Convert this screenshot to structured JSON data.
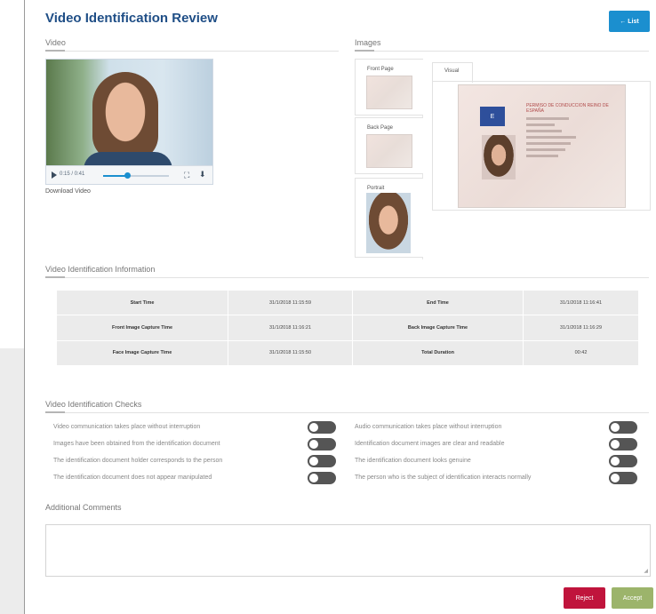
{
  "page": {
    "title": "Video Identification Review",
    "list_button": "List",
    "list_icon": "←"
  },
  "video_section": {
    "heading": "Video",
    "time": "0:15 / 0:41",
    "progress": 0.37,
    "download_link": "Download Video"
  },
  "images_section": {
    "heading": "Images",
    "thumbnails": [
      {
        "label": "Front Page"
      },
      {
        "label": "Back Page"
      },
      {
        "label": "Portrait"
      }
    ],
    "visual_tab": "Visual",
    "card": {
      "flag_text": "E",
      "header": "PERMISO DE CONDUCCION  REINO DE ESPAÑA"
    }
  },
  "info_section": {
    "heading": "Video Identification Information",
    "rows": [
      {
        "label1": "Start Time",
        "value1": "31/1/2018 11:15:59",
        "label2": "End Time",
        "value2": "31/1/2018 11:16:41"
      },
      {
        "label1": "Front Image Capture Time",
        "value1": "31/1/2018 11:16:21",
        "label2": "Back Image Capture Time",
        "value2": "31/1/2018 11:16:29"
      },
      {
        "label1": "Face Image Capture Time",
        "value1": "31/1/2018 11:15:50",
        "label2": "Total Duration",
        "value2": "00:42"
      }
    ]
  },
  "checks_section": {
    "heading": "Video Identification Checks",
    "left": [
      "Video communication takes place without interruption",
      "Images have been obtained from the identification document",
      "The identification document holder corresponds to the person",
      "The identification document does not appear manipulated"
    ],
    "right": [
      "Audio communication takes place without interruption",
      "Identification document images are clear and readable",
      "The identification document looks genuine",
      "The person who is the subject of identification interacts normally"
    ]
  },
  "comments": {
    "heading": "Additional Comments",
    "value": ""
  },
  "actions": {
    "reject": "Reject",
    "accept": "Accept"
  },
  "colors": {
    "title": "#1f4e86",
    "primary": "#1b8fcf",
    "reject": "#c0143c",
    "accept": "#9cb46b",
    "toggle_off": "#555555"
  }
}
